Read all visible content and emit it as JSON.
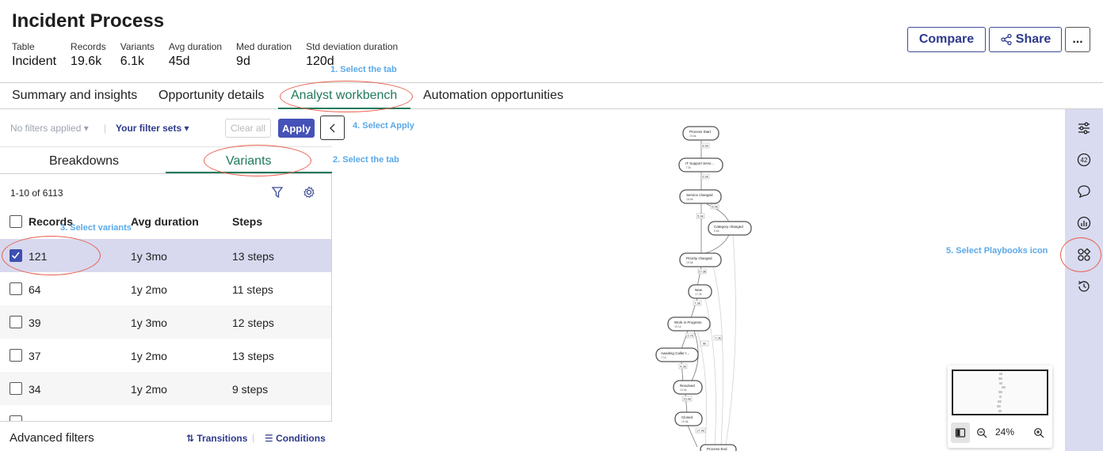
{
  "header": {
    "title": "Incident Process",
    "stats": [
      {
        "label": "Table",
        "value": "Incident"
      },
      {
        "label": "Records",
        "value": "19.6k"
      },
      {
        "label": "Variants",
        "value": "6.1k"
      },
      {
        "label": "Avg duration",
        "value": "45d"
      },
      {
        "label": "Med duration",
        "value": "9d"
      },
      {
        "label": "Std deviation duration",
        "value": "120d"
      }
    ],
    "compare_label": "Compare",
    "share_label": "Share",
    "more_label": "..."
  },
  "tabs": {
    "summary": "Summary and insights",
    "opportunity": "Opportunity details",
    "analyst": "Analyst workbench",
    "automation": "Automation opportunities"
  },
  "filters": {
    "no_filters": "No filters applied ▾",
    "separator": "|",
    "filter_sets": "Your filter sets ▾",
    "clear_label": "Clear all",
    "apply_label": "Apply"
  },
  "subtabs": {
    "breakdowns": "Breakdowns",
    "variants": "Variants"
  },
  "variants": {
    "count": "1-10 of 6113",
    "columns": {
      "records": "Records",
      "avg_duration": "Avg duration",
      "steps": "Steps"
    },
    "rows": [
      {
        "records": "121",
        "duration": "1y 3mo",
        "steps": "13 steps",
        "checked": true
      },
      {
        "records": "64",
        "duration": "1y 2mo",
        "steps": "11 steps",
        "checked": false
      },
      {
        "records": "39",
        "duration": "1y 3mo",
        "steps": "12 steps",
        "checked": false
      },
      {
        "records": "37",
        "duration": "1y 2mo",
        "steps": "13 steps",
        "checked": false
      },
      {
        "records": "34",
        "duration": "1y 2mo",
        "steps": "9 steps",
        "checked": false
      }
    ]
  },
  "advanced": {
    "title": "Advanced filters",
    "transitions": "⇅ Transitions",
    "separator": "|",
    "conditions": "☰ Conditions"
  },
  "process_map": {
    "nodes": [
      {
        "label": "Process Start",
        "sub": "19.6k"
      },
      {
        "label": "IT Support Servi...",
        "sub": "7.3k"
      },
      {
        "label": "Service changed",
        "sub": "18.6k"
      },
      {
        "label": "Category changed",
        "sub": "5.6k"
      },
      {
        "label": "Priority changed",
        "sub": "19.6k"
      },
      {
        "label": "New",
        "sub": "17.3k"
      },
      {
        "label": "Work in Progress",
        "sub": "15.1k"
      },
      {
        "label": "Awaiting Caller I...",
        "sub": "7.1k"
      },
      {
        "label": "Resolved",
        "sub": "19.6k"
      },
      {
        "label": "Closed",
        "sub": "19.6k"
      },
      {
        "label": "Process End",
        "sub": ""
      }
    ],
    "edge_labels": [
      "8.9k",
      "6.3k",
      "5.9k",
      "6.9k",
      "17.3k",
      "7.3k",
      "3.7k",
      "9k",
      "4.3k",
      "15.4k",
      "17.9k",
      "7.3k"
    ]
  },
  "minimap": {
    "zoom": "24%"
  },
  "annotations": {
    "a1": "1. Select the tab",
    "a2": "2. Select the tab",
    "a3": "3. Select variants",
    "a4": "4. Select Apply",
    "a5": "5. Select Playbooks icon"
  },
  "colors": {
    "accent": "#217a5a",
    "primary": "#4552b8",
    "annotation": "#5ba9e8",
    "highlight_ring": "#e8604d",
    "selected_row": "#d8d9ef",
    "right_bar": "#d9dbf1"
  }
}
